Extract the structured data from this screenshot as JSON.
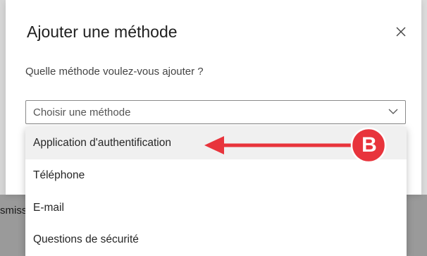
{
  "background": {
    "snippet": "smiss"
  },
  "dialog": {
    "title": "Ajouter une méthode",
    "question": "Quelle méthode voulez-vous ajouter ?",
    "select": {
      "placeholder": "Choisir une méthode"
    },
    "options": [
      {
        "label": "Application d'authentification",
        "highlighted": true
      },
      {
        "label": "Téléphone",
        "highlighted": false
      },
      {
        "label": "E-mail",
        "highlighted": false
      },
      {
        "label": "Questions de sécurité",
        "highlighted": false
      }
    ]
  },
  "annotation": {
    "badge_label": "B",
    "color": "#e8343c"
  },
  "icons": {
    "close": "close-icon",
    "chevron": "chevron-down-icon"
  },
  "colors": {
    "option_highlight": "#f0f0f0",
    "dim_overlay": "#9a9a9a"
  }
}
